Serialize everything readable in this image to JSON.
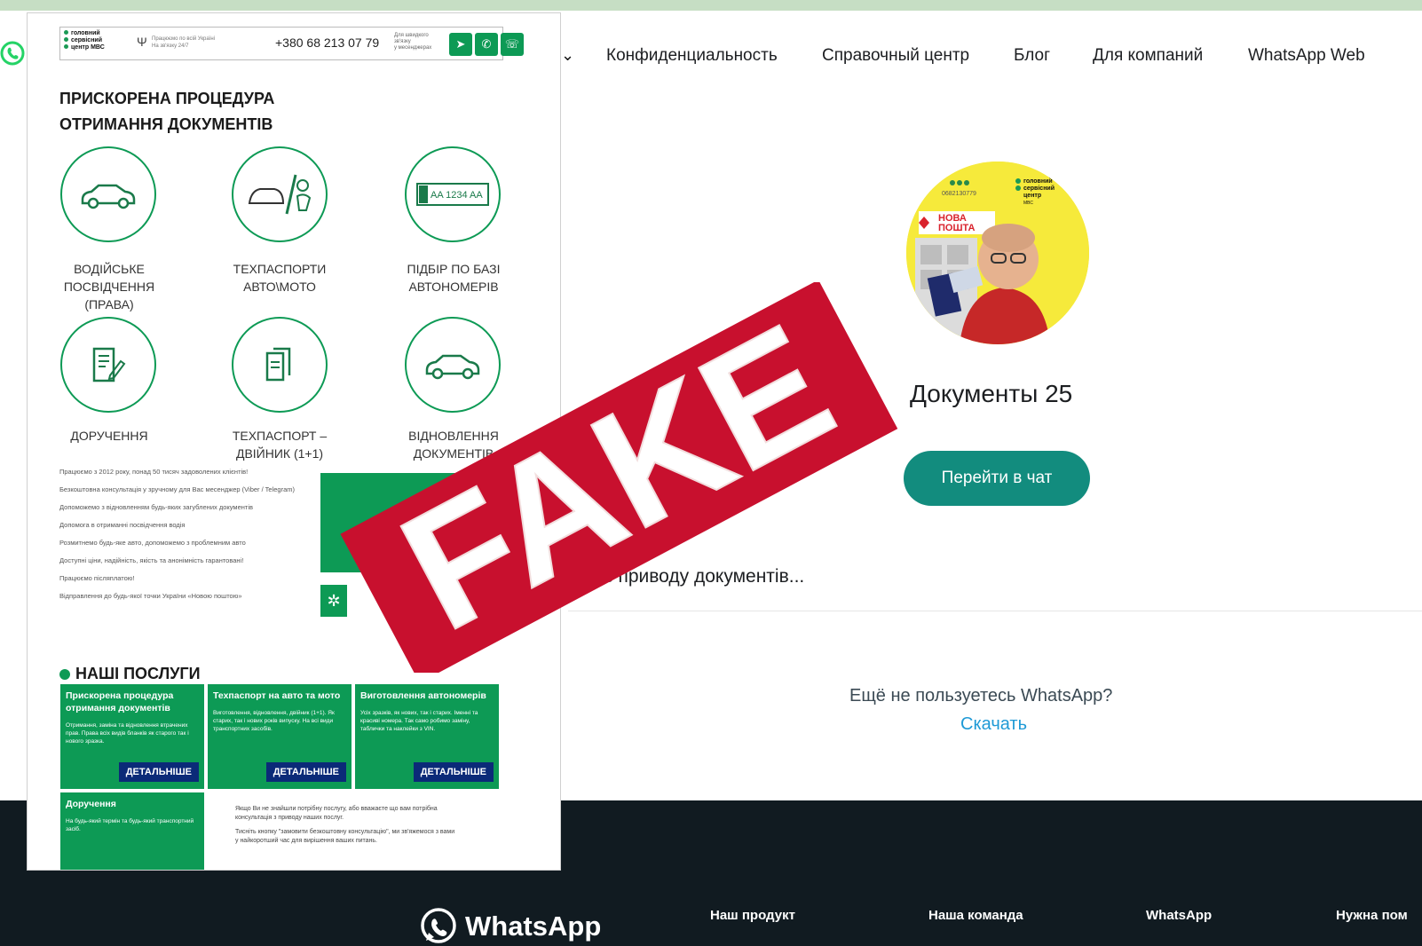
{
  "nav": {
    "links": [
      "Конфиденциальность",
      "Справочный центр",
      "Блог",
      "Для компаний",
      "WhatsApp Web"
    ]
  },
  "profile": {
    "name": "Документы 25",
    "chat_button": "Перейти в чат",
    "preview": "Я з приводу документів..."
  },
  "promo": {
    "question": "Ещё не пользуетесь WhatsApp?",
    "download": "Скачать"
  },
  "footer": {
    "logo": "WhatsApp",
    "columns": [
      "Наш продукт",
      "Наша команда",
      "WhatsApp",
      "Нужна пом"
    ]
  },
  "avatar_image": {
    "brand_lines": [
      "головний",
      "сервісний",
      "центр"
    ],
    "brand_small": "МВС",
    "phone": "0682130779",
    "nova_poshta": [
      "НОВА",
      "ПОШТА"
    ]
  },
  "left_site": {
    "logo_lines": [
      "головний",
      "сервісний",
      "центр МВС"
    ],
    "work_note": [
      "Працюємо по всій Україні",
      "На зв'язку 24/7"
    ],
    "phone": "+380 68 213 07 79",
    "contact_note": [
      "Для швидкого",
      "зв'язку",
      "у месенджерах"
    ],
    "title_lines": [
      "ПРИСКОРЕНА ПРОЦЕДУРА",
      "ОТРИМАННЯ ДОКУМЕНТІВ"
    ],
    "plate_text": "AA 1234 AA",
    "services_icons": [
      {
        "label": [
          "ВОДІЙСЬКЕ",
          "ПОСВІДЧЕННЯ",
          "(ПРАВА)"
        ],
        "icon": "car-icon"
      },
      {
        "label": [
          "ТЕХПАСПОРТИ",
          "АВТО\\МОТО"
        ],
        "icon": "car-moto-icon"
      },
      {
        "label": [
          "ПІДБІР ПО БАЗІ",
          "АВТОНОМЕРІВ"
        ],
        "icon": "license-plate-icon"
      },
      {
        "label": [
          "ДОРУЧЕННЯ"
        ],
        "icon": "document-pen-icon"
      },
      {
        "label": [
          "ТЕХПАСПОРТ –",
          "ДВІЙНИК (1+1)"
        ],
        "icon": "copy-document-icon"
      },
      {
        "label": [
          "ВІДНОВЛЕННЯ",
          "ДОКУМЕНТІВ"
        ],
        "icon": "car-icon"
      }
    ],
    "bullets": [
      "Працюємо з 2012 року, понад 50 тисяч задоволених клієнтів!",
      "Безкоштовна консультація у зручному для Вас месенджер (Viber / Telegram)",
      "Допоможемо з відновленням будь-яких загублених документів",
      "Допомога в отриманні посвідчення водія",
      "Розмитнемо будь-яке авто, допоможемо з проблемним авто",
      "Доступні ціни, надійність, якість та анонімність гарантовані!",
      "Працюємо післяплатою!",
      "Відправлення до будь-якої точки України «Новою поштою»"
    ],
    "services_heading": "НАШІ ПОСЛУГИ",
    "cards": [
      {
        "title": "Прискорена процедура отримання документів",
        "text": "Отримання, заміна та відновлення втрачених прав. Права всіх видів бланків як старого так і нового зразка.",
        "button": "ДЕТАЛЬНІШЕ"
      },
      {
        "title": "Техпаспорт на авто та мото",
        "text": "Виготовлення, відновлення, двійник (1+1). Як старих, так і нових років випуску. На всі види транспортних засобів.",
        "button": "ДЕТАЛЬНІШЕ"
      },
      {
        "title": "Виготовлення автономерів",
        "text": "Усіх зразків, як нових, так і старих. Іменні та красиві номера. Так само робимо заміну, таблички та наклейки з VIN.",
        "button": "ДЕТАЛЬНІШЕ"
      },
      {
        "title": "Доручення",
        "text": "На будь-який термін та будь-який транспортний засіб.",
        "button": ""
      }
    ],
    "note": [
      "Якщо Ви не знайшли потрібну послугу, або вважаєте що вам потрібна консультація з приводу наших послуг.",
      "Тисніть кнопку \"замовити безкоштовну консультацію\", ми зв'яжемося з вами у найкоротший час для вирішення ваших питань."
    ]
  },
  "stamp": {
    "text": "FAKE",
    "color": "#c8102e"
  },
  "colors": {
    "wa_green": "#128c7e",
    "site_green": "#0d9a55",
    "footer_bg": "#111b21",
    "link_blue": "#1f9ad6"
  }
}
